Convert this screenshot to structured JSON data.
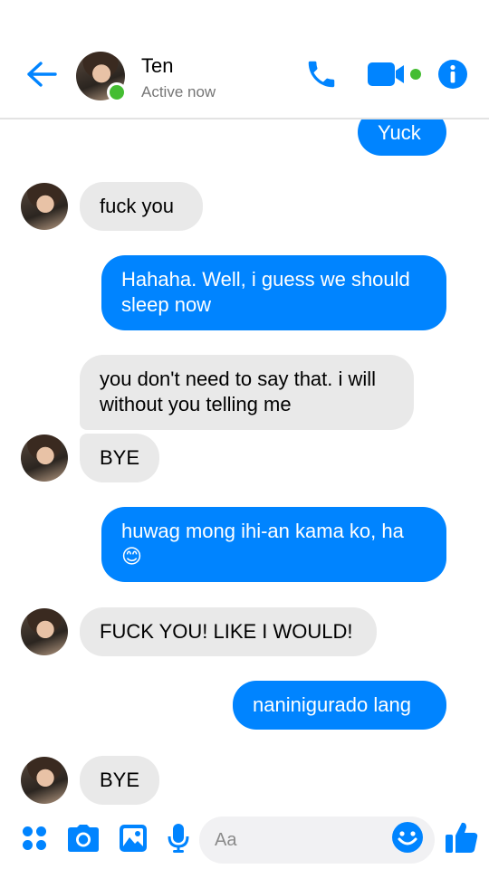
{
  "header": {
    "contact_name": "Ten",
    "status": "Active now",
    "accent_color": "#0084ff",
    "online_color": "#44bd32",
    "icons": [
      "back-arrow-icon",
      "phone-icon",
      "video-camera-icon",
      "info-icon"
    ]
  },
  "messages": [
    {
      "id": "m1",
      "direction": "outgoing",
      "text": "Yuck"
    },
    {
      "id": "m2",
      "direction": "incoming",
      "text": "fuck you",
      "show_avatar": true
    },
    {
      "id": "m3",
      "direction": "outgoing",
      "text": "Hahaha. Well, i guess we should sleep now"
    },
    {
      "id": "m4",
      "direction": "incoming",
      "text": "you don't need to say that. i will without you telling me",
      "show_avatar": false
    },
    {
      "id": "m5",
      "direction": "incoming",
      "text": "BYE",
      "show_avatar": true
    },
    {
      "id": "m6",
      "direction": "outgoing",
      "text": "huwag mong ihi-an kama ko, ha 😊"
    },
    {
      "id": "m7",
      "direction": "incoming",
      "text": "FUCK YOU! LIKE I WOULD!",
      "show_avatar": true
    },
    {
      "id": "m8",
      "direction": "outgoing",
      "text": "naninigurado lang"
    },
    {
      "id": "m9",
      "direction": "incoming",
      "text": "BYE",
      "show_avatar": true
    }
  ],
  "composer": {
    "placeholder": "Aa",
    "value": "",
    "icons": [
      "apps-grid-icon",
      "camera-icon",
      "image-icon",
      "microphone-icon",
      "emoji-icon",
      "thumbs-up-icon"
    ]
  },
  "colors": {
    "outgoing_bubble": "#0084ff",
    "incoming_bubble": "#e9e9e9"
  }
}
